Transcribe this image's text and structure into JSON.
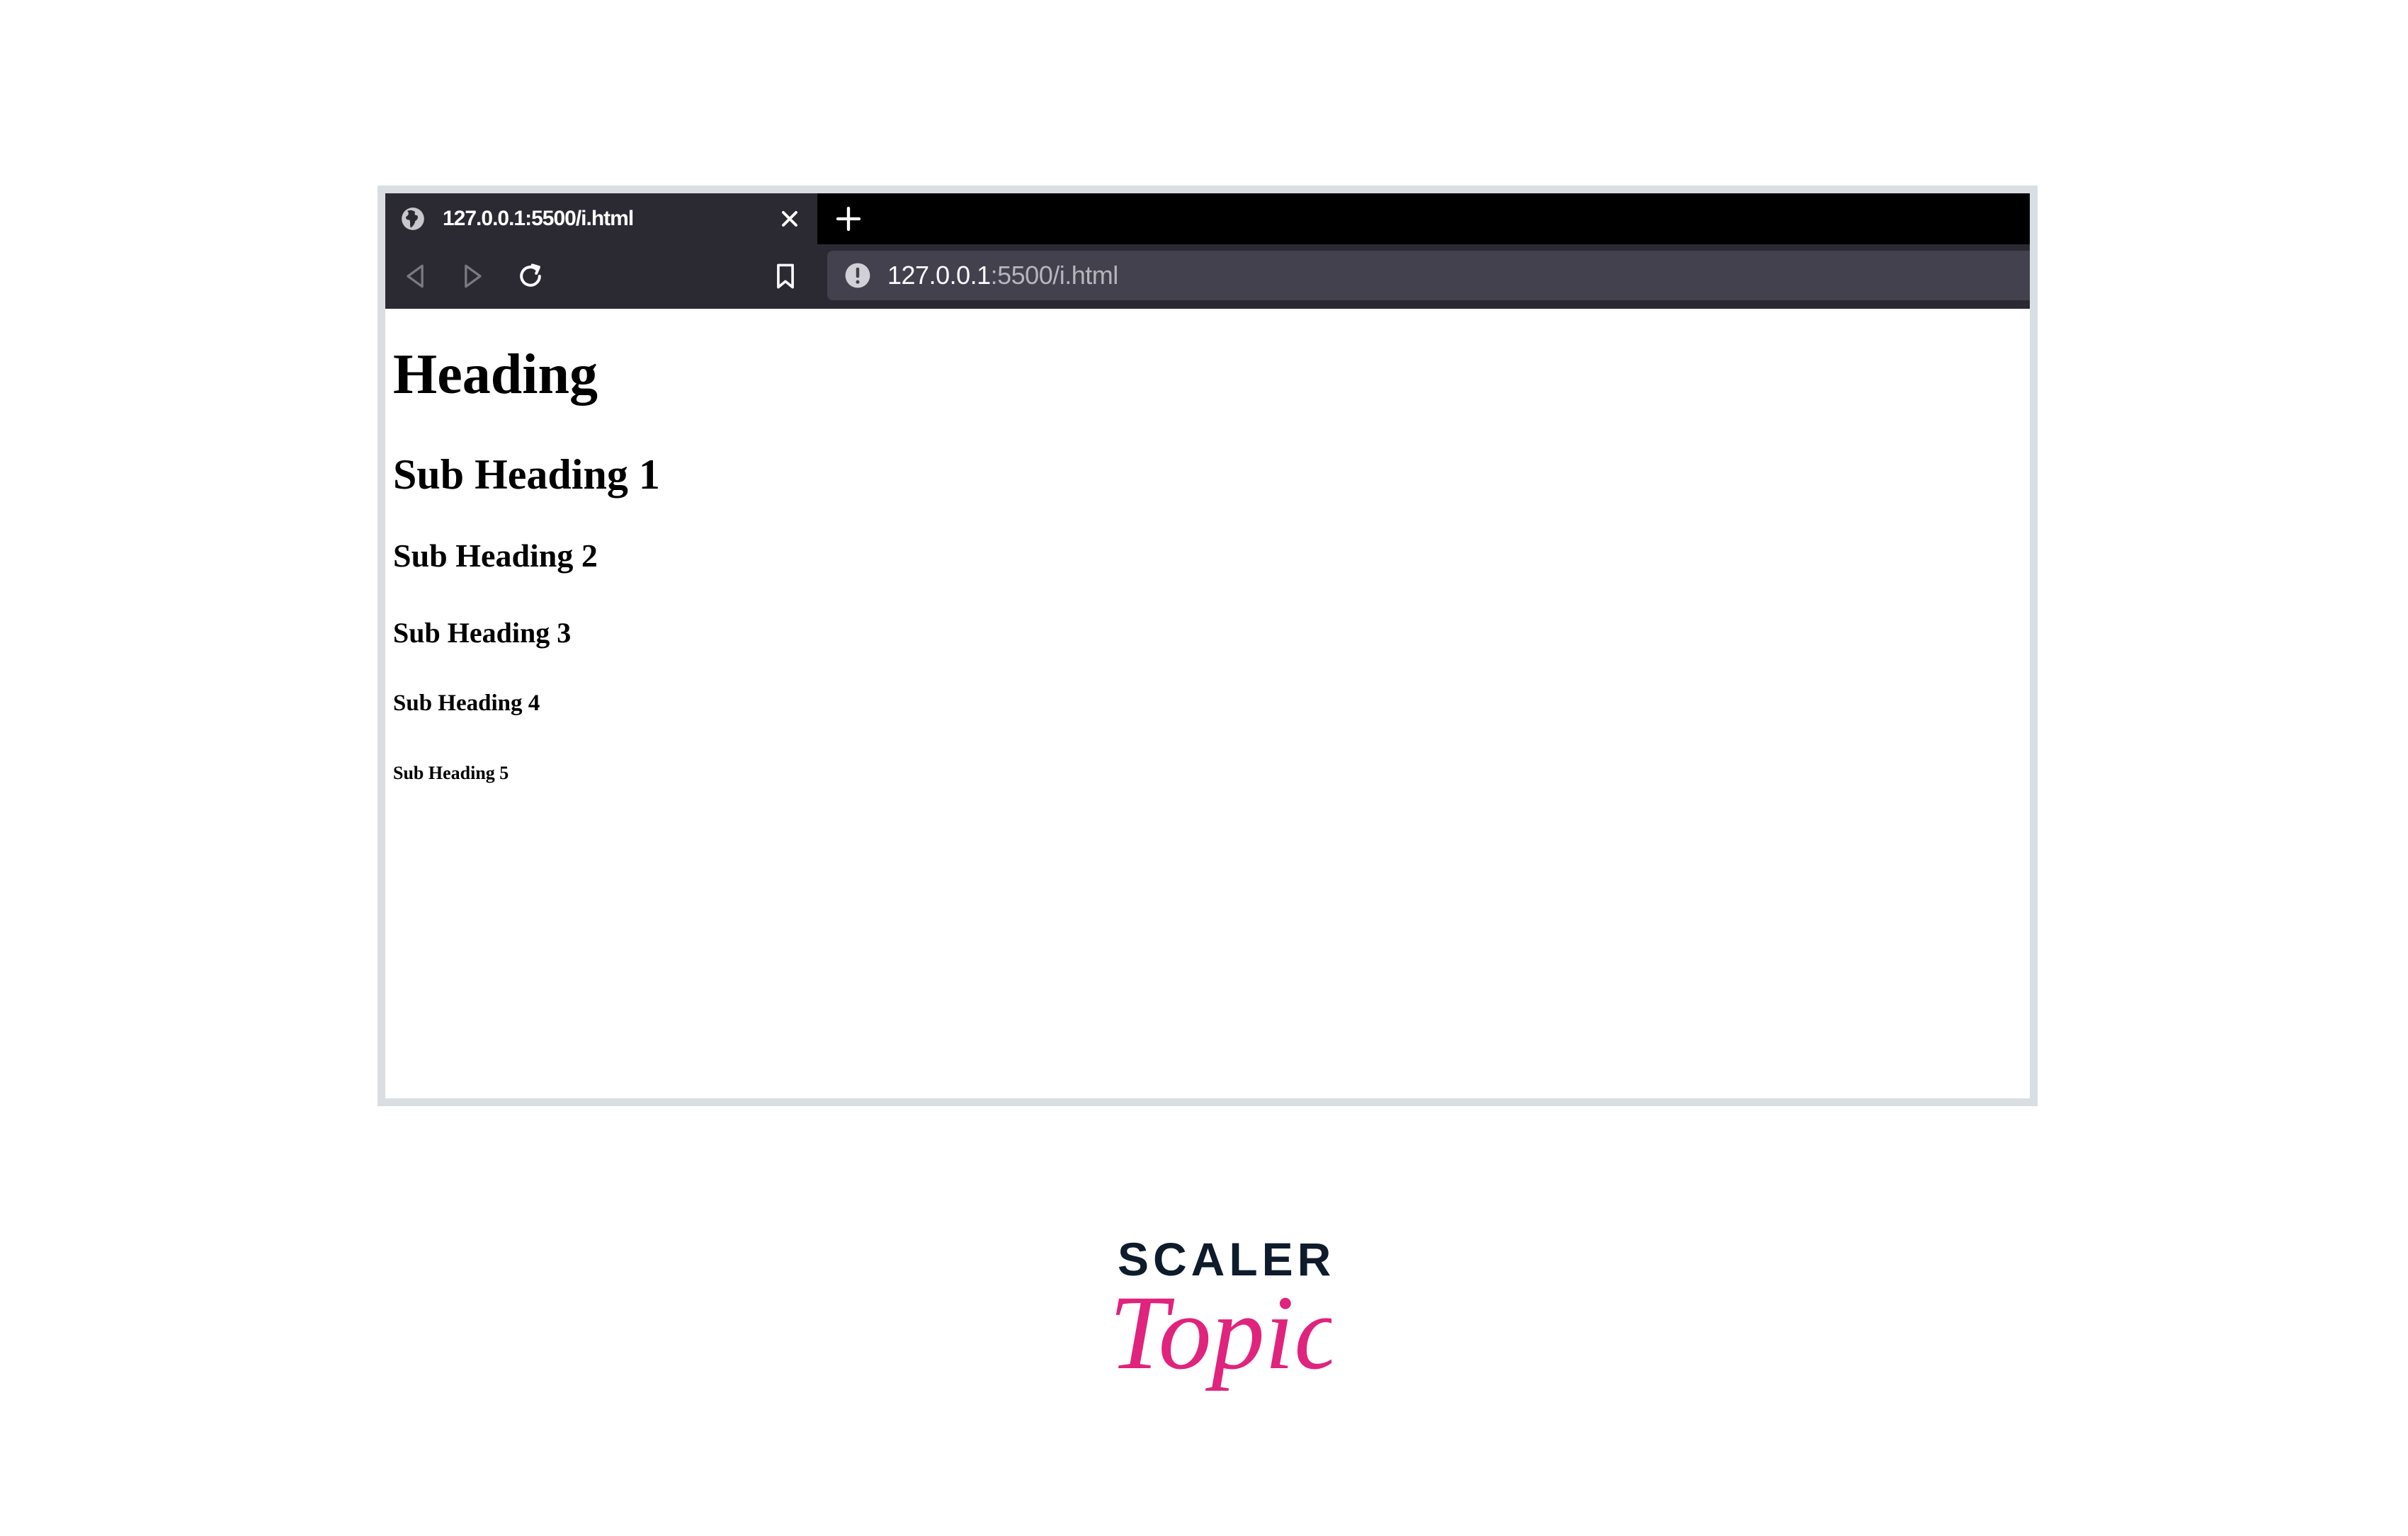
{
  "browser": {
    "tab": {
      "title": "127.0.0.1:5500/i.html",
      "favicon": "globe-icon",
      "close_icon": "close-icon"
    },
    "new_tab_icon": "plus-icon",
    "toolbar": {
      "back_icon": "back-arrow-icon",
      "forward_icon": "forward-arrow-icon",
      "reload_icon": "reload-icon",
      "bookmark_icon": "bookmark-icon"
    },
    "url": {
      "host": "127.0.0.1",
      "path": ":5500/i.html",
      "info_icon": "info-icon"
    },
    "colors": {
      "tabbar": "#000000",
      "toolbar": "#2b2a33",
      "urlbar": "#42414d",
      "frame_border": "#d9dee3"
    }
  },
  "page": {
    "headings": [
      "Heading",
      "Sub Heading 1",
      "Sub Heading 2",
      "Sub Heading 3",
      "Sub Heading 4",
      "Sub Heading 5"
    ]
  },
  "branding": {
    "word_top": "SCALER",
    "word_bottom": "Topics",
    "colors": {
      "scaler": "#0d1b2a",
      "topics": "#e0237c"
    }
  }
}
